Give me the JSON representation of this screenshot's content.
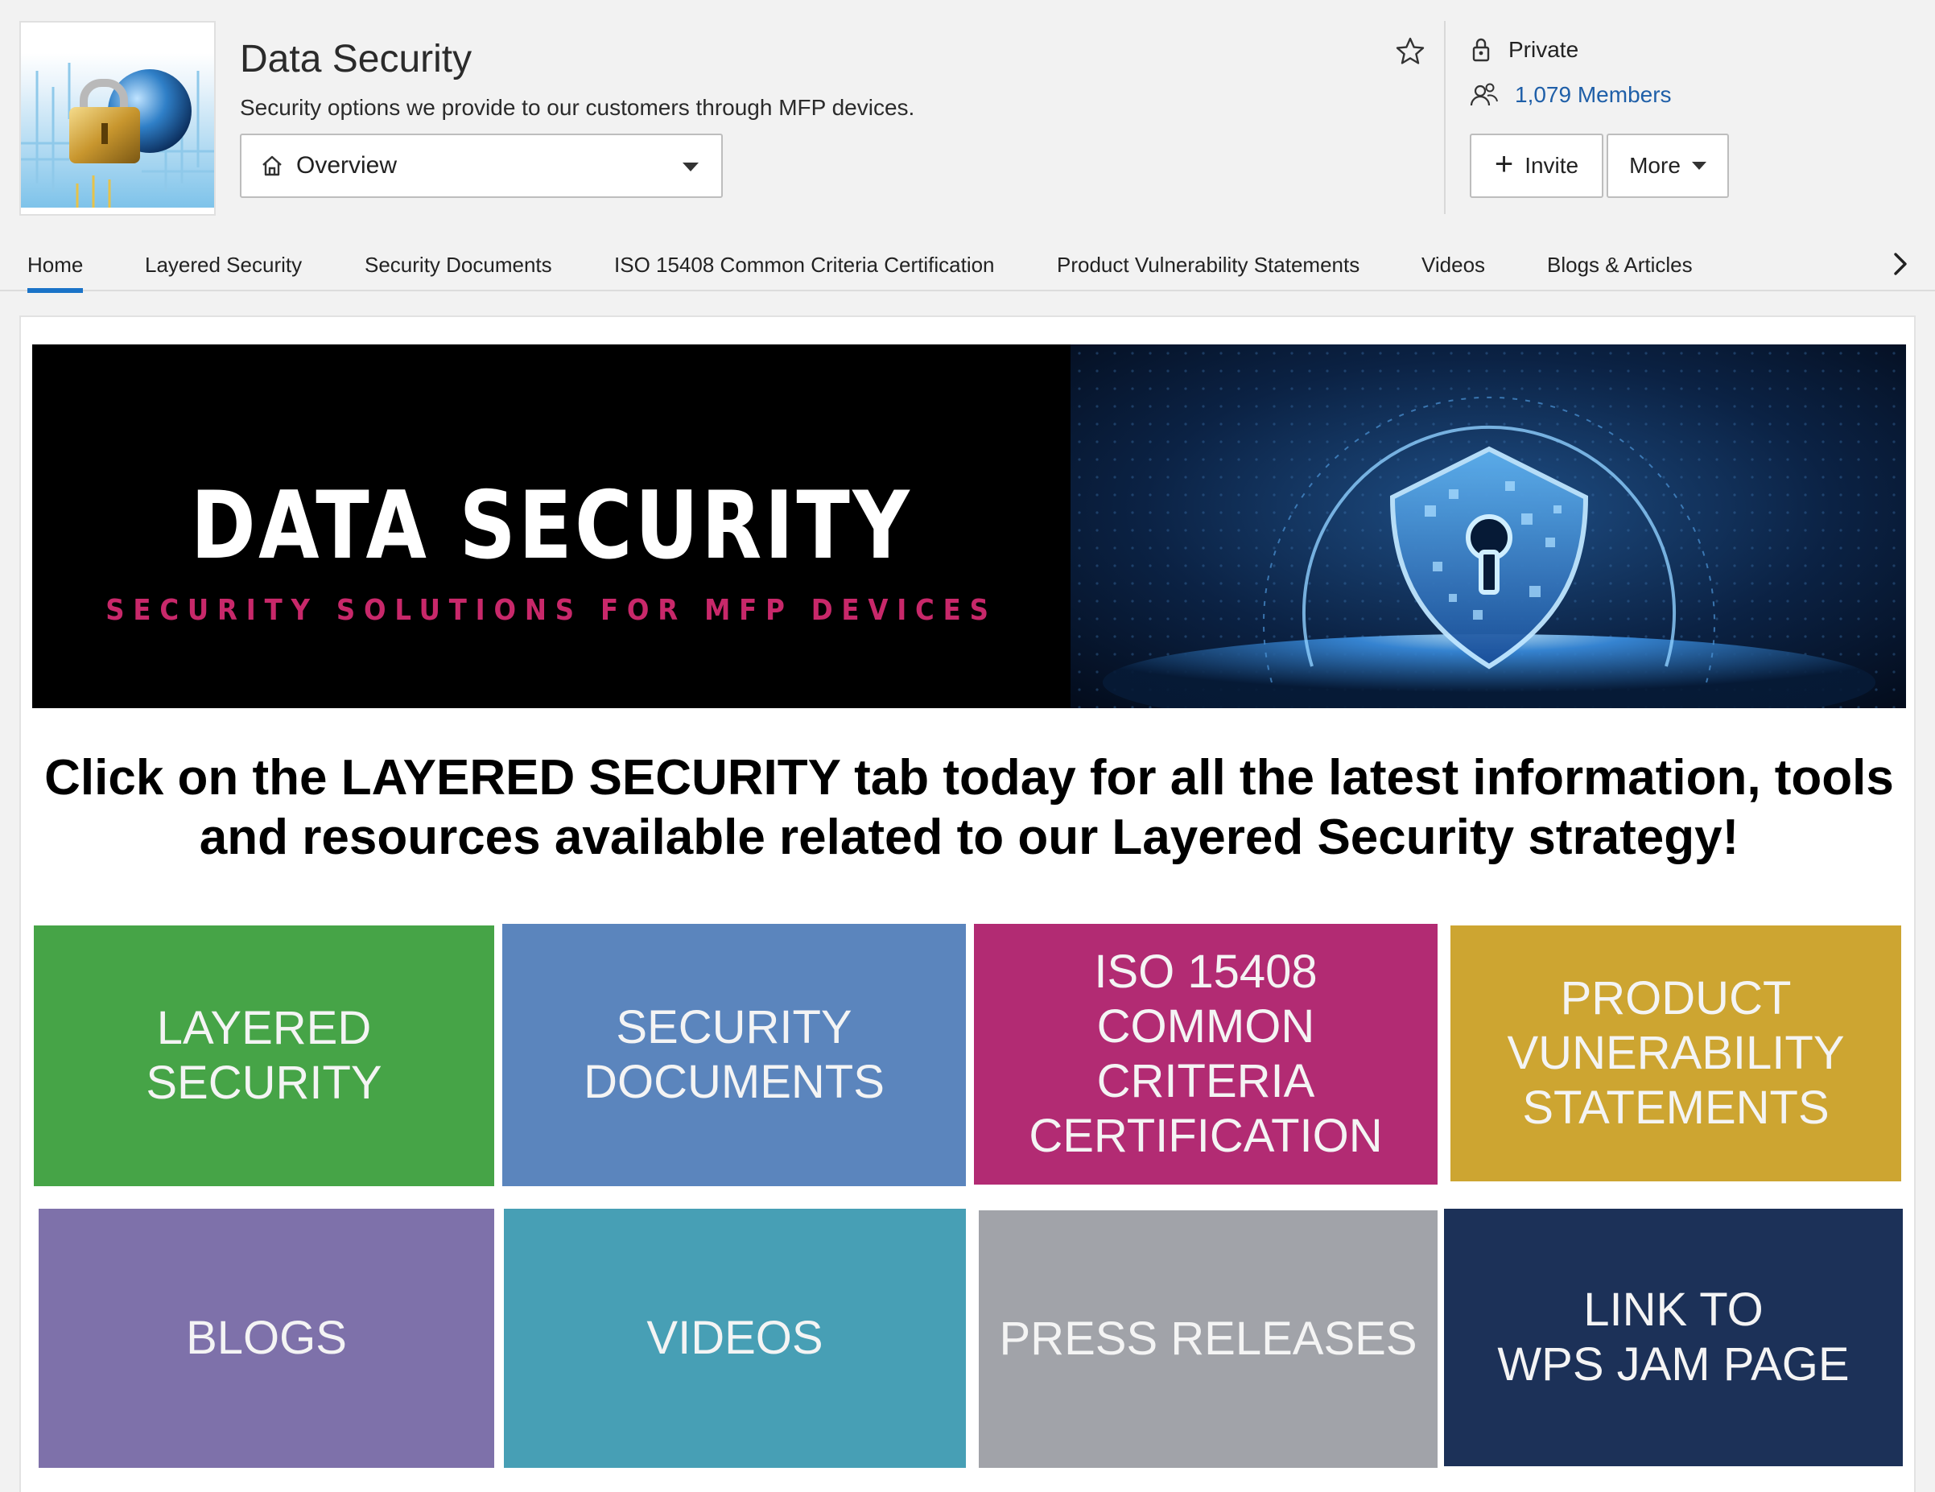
{
  "group": {
    "title": "Data Security",
    "description": "Security options we provide to our customers through MFP devices.",
    "privacy": "Private",
    "members": "1,079 Members"
  },
  "overview_select": {
    "value": "Overview"
  },
  "actions": {
    "invite": "Invite",
    "more": "More"
  },
  "tabs": [
    {
      "label": "Home"
    },
    {
      "label": "Layered Security"
    },
    {
      "label": "Security Documents"
    },
    {
      "label": "ISO 15408 Common Criteria Certification"
    },
    {
      "label": "Product Vulnerability Statements"
    },
    {
      "label": "Videos"
    },
    {
      "label": "Blogs & Articles"
    }
  ],
  "banner": {
    "title": "DATA SECURITY",
    "subtitle": "SECURITY SOLUTIONS FOR MFP DEVICES"
  },
  "headline": "Click on the LAYERED SECURITY tab today for all the latest information, tools and resources available related to our Layered Security strategy!",
  "tiles": [
    {
      "label": "LAYERED\nSECURITY",
      "color": "#46a447"
    },
    {
      "label": "SECURITY\nDOCUMENTS",
      "color": "#5b85bd"
    },
    {
      "label": "ISO 15408\nCOMMON\nCRITERIA\nCERTIFICATION",
      "color": "#b22b73"
    },
    {
      "label": "PRODUCT\nVUNERABILITY\nSTATEMENTS",
      "color": "#cda531"
    },
    {
      "label": "BLOGS",
      "color": "#7e71aa"
    },
    {
      "label": "VIDEOS",
      "color": "#479fb5"
    },
    {
      "label": "PRESS RELEASES",
      "color": "#a1a3a9"
    },
    {
      "label": "LINK TO\nWPS JAM PAGE",
      "color": "#1c3158"
    }
  ]
}
